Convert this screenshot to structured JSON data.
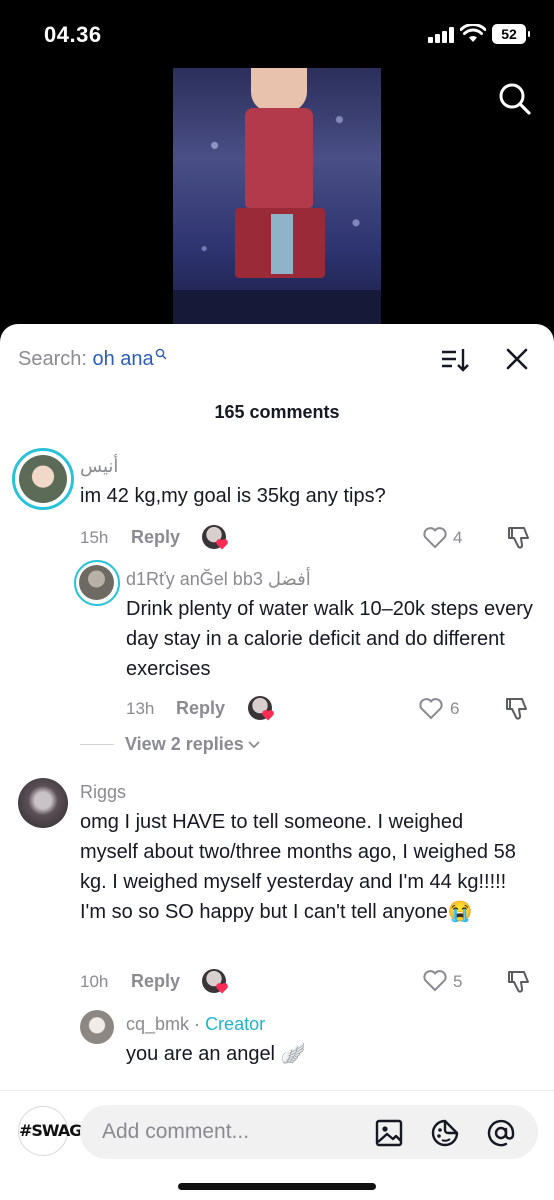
{
  "status_bar": {
    "time": "04.36",
    "battery": "52"
  },
  "sheet": {
    "search_label": "Search:",
    "search_term": "oh ana",
    "comment_count": "165 comments"
  },
  "comments": [
    {
      "username": "أنيس",
      "text": "im 42 kg,my goal is 35kg any tips?",
      "time": "15h",
      "reply": "Reply",
      "likes": "4"
    },
    {
      "username": "d1Rťy anĞel bb3 أفضل",
      "text": "Drink plenty of water walk 10–20k steps every day stay in a calorie deficit and do different exercises",
      "time": "13h",
      "reply": "Reply",
      "likes": "6"
    },
    {
      "username": "Riggs",
      "text": "omg I just HAVE to tell someone. I weighed myself about two/three months ago, I weighed 58 kg. I weighed myself yesterday and I'm 44 kg!!!!! I'm so so SO happy but I can't tell anyone😭",
      "time": "10h",
      "reply": "Reply",
      "likes": "5"
    },
    {
      "username": "cq_bmk",
      "separator": "·",
      "badge": "Creator",
      "text": "you are an angel 🪽"
    }
  ],
  "view_replies": "View 2 replies",
  "bottom_bar": {
    "avatar_label": "#SWAG",
    "placeholder": "Add comment..."
  },
  "colors": {
    "accent_search": "#2b5db8",
    "creator_badge": "#1fb5c9",
    "like_heart": "#fe2c55"
  }
}
